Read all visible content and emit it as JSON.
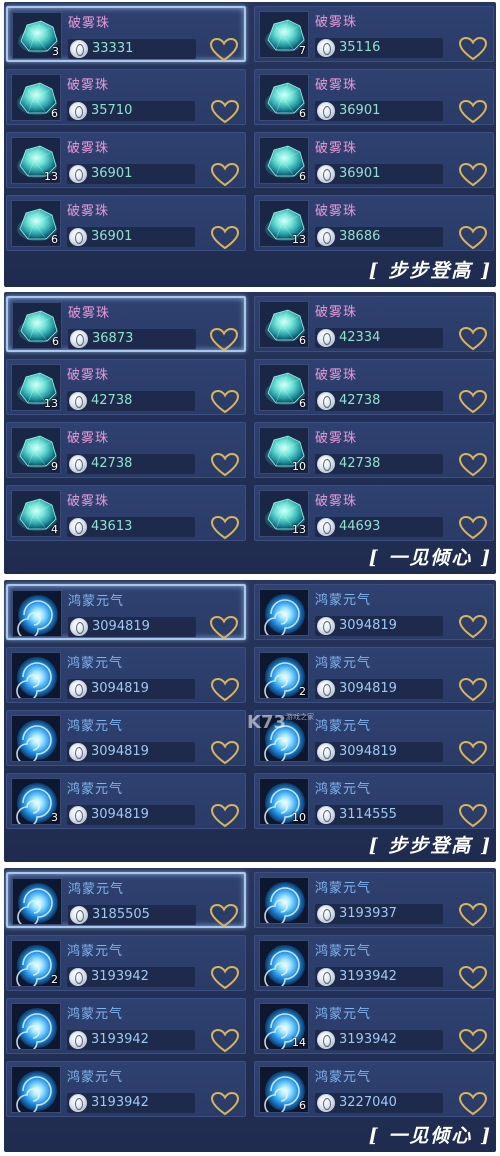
{
  "icons": {
    "stone": "crystal-stone-icon",
    "swirl": "blue-swirl-icon",
    "coin": "silver-coin-icon",
    "heart": "heart-outline-icon"
  },
  "colors": {
    "panel_bg": "#243259",
    "item_bg": "#2c3d6a",
    "name_pink": "#e89ad8",
    "name_blue": "#7fb4ef",
    "price_green": "#8fe0cf",
    "price_blue": "#9ec8f5",
    "heart_gold": "#d9b45a"
  },
  "panels": [
    {
      "tag": "[ 步步登高 ]",
      "items": [
        {
          "name": "破雾珠",
          "qty": "3",
          "price": "33331",
          "icon": "stone",
          "selected": true
        },
        {
          "name": "破雾珠",
          "qty": "7",
          "price": "35116",
          "icon": "stone"
        },
        {
          "name": "破雾珠",
          "qty": "6",
          "price": "35710",
          "icon": "stone"
        },
        {
          "name": "破雾珠",
          "qty": "6",
          "price": "36901",
          "icon": "stone"
        },
        {
          "name": "破雾珠",
          "qty": "13",
          "price": "36901",
          "icon": "stone"
        },
        {
          "name": "破雾珠",
          "qty": "6",
          "price": "36901",
          "icon": "stone"
        },
        {
          "name": "破雾珠",
          "qty": "6",
          "price": "36901",
          "icon": "stone"
        },
        {
          "name": "破雾珠",
          "qty": "13",
          "price": "38686",
          "icon": "stone"
        }
      ]
    },
    {
      "tag": "[ 一见倾心 ]",
      "items": [
        {
          "name": "破雾珠",
          "qty": "6",
          "price": "36873",
          "icon": "stone",
          "selected": true
        },
        {
          "name": "破雾珠",
          "qty": "6",
          "price": "42334",
          "icon": "stone"
        },
        {
          "name": "破雾珠",
          "qty": "13",
          "price": "42738",
          "icon": "stone"
        },
        {
          "name": "破雾珠",
          "qty": "6",
          "price": "42738",
          "icon": "stone"
        },
        {
          "name": "破雾珠",
          "qty": "9",
          "price": "42738",
          "icon": "stone"
        },
        {
          "name": "破雾珠",
          "qty": "10",
          "price": "42738",
          "icon": "stone"
        },
        {
          "name": "破雾珠",
          "qty": "4",
          "price": "43613",
          "icon": "stone"
        },
        {
          "name": "破雾珠",
          "qty": "13",
          "price": "44693",
          "icon": "stone"
        }
      ]
    },
    {
      "tag": "[ 步步登高 ]",
      "items": [
        {
          "name": "鸿蒙元气",
          "qty": "",
          "price": "3094819",
          "icon": "swirl",
          "selected": true
        },
        {
          "name": "鸿蒙元气",
          "qty": "",
          "price": "3094819",
          "icon": "swirl"
        },
        {
          "name": "鸿蒙元气",
          "qty": "",
          "price": "3094819",
          "icon": "swirl"
        },
        {
          "name": "鸿蒙元气",
          "qty": "2",
          "price": "3094819",
          "icon": "swirl"
        },
        {
          "name": "鸿蒙元气",
          "qty": "",
          "price": "3094819",
          "icon": "swirl"
        },
        {
          "name": "鸿蒙元气",
          "qty": "",
          "price": "3094819",
          "icon": "swirl"
        },
        {
          "name": "鸿蒙元气",
          "qty": "3",
          "price": "3094819",
          "icon": "swirl"
        },
        {
          "name": "鸿蒙元气",
          "qty": "10",
          "price": "3114555",
          "icon": "swirl"
        }
      ]
    },
    {
      "tag": "[ 一见倾心 ]",
      "items": [
        {
          "name": "鸿蒙元气",
          "qty": "",
          "price": "3185505",
          "icon": "swirl",
          "selected": true
        },
        {
          "name": "鸿蒙元气",
          "qty": "",
          "price": "3193937",
          "icon": "swirl"
        },
        {
          "name": "鸿蒙元气",
          "qty": "2",
          "price": "3193942",
          "icon": "swirl"
        },
        {
          "name": "鸿蒙元气",
          "qty": "",
          "price": "3193942",
          "icon": "swirl"
        },
        {
          "name": "鸿蒙元气",
          "qty": "",
          "price": "3193942",
          "icon": "swirl"
        },
        {
          "name": "鸿蒙元气",
          "qty": "14",
          "price": "3193942",
          "icon": "swirl"
        },
        {
          "name": "鸿蒙元气",
          "qty": "",
          "price": "3193942",
          "icon": "swirl"
        },
        {
          "name": "鸿蒙元气",
          "qty": "6",
          "price": "3227040",
          "icon": "swirl"
        }
      ]
    }
  ],
  "watermark": {
    "text": "K73",
    "sub": "游戏之家"
  }
}
